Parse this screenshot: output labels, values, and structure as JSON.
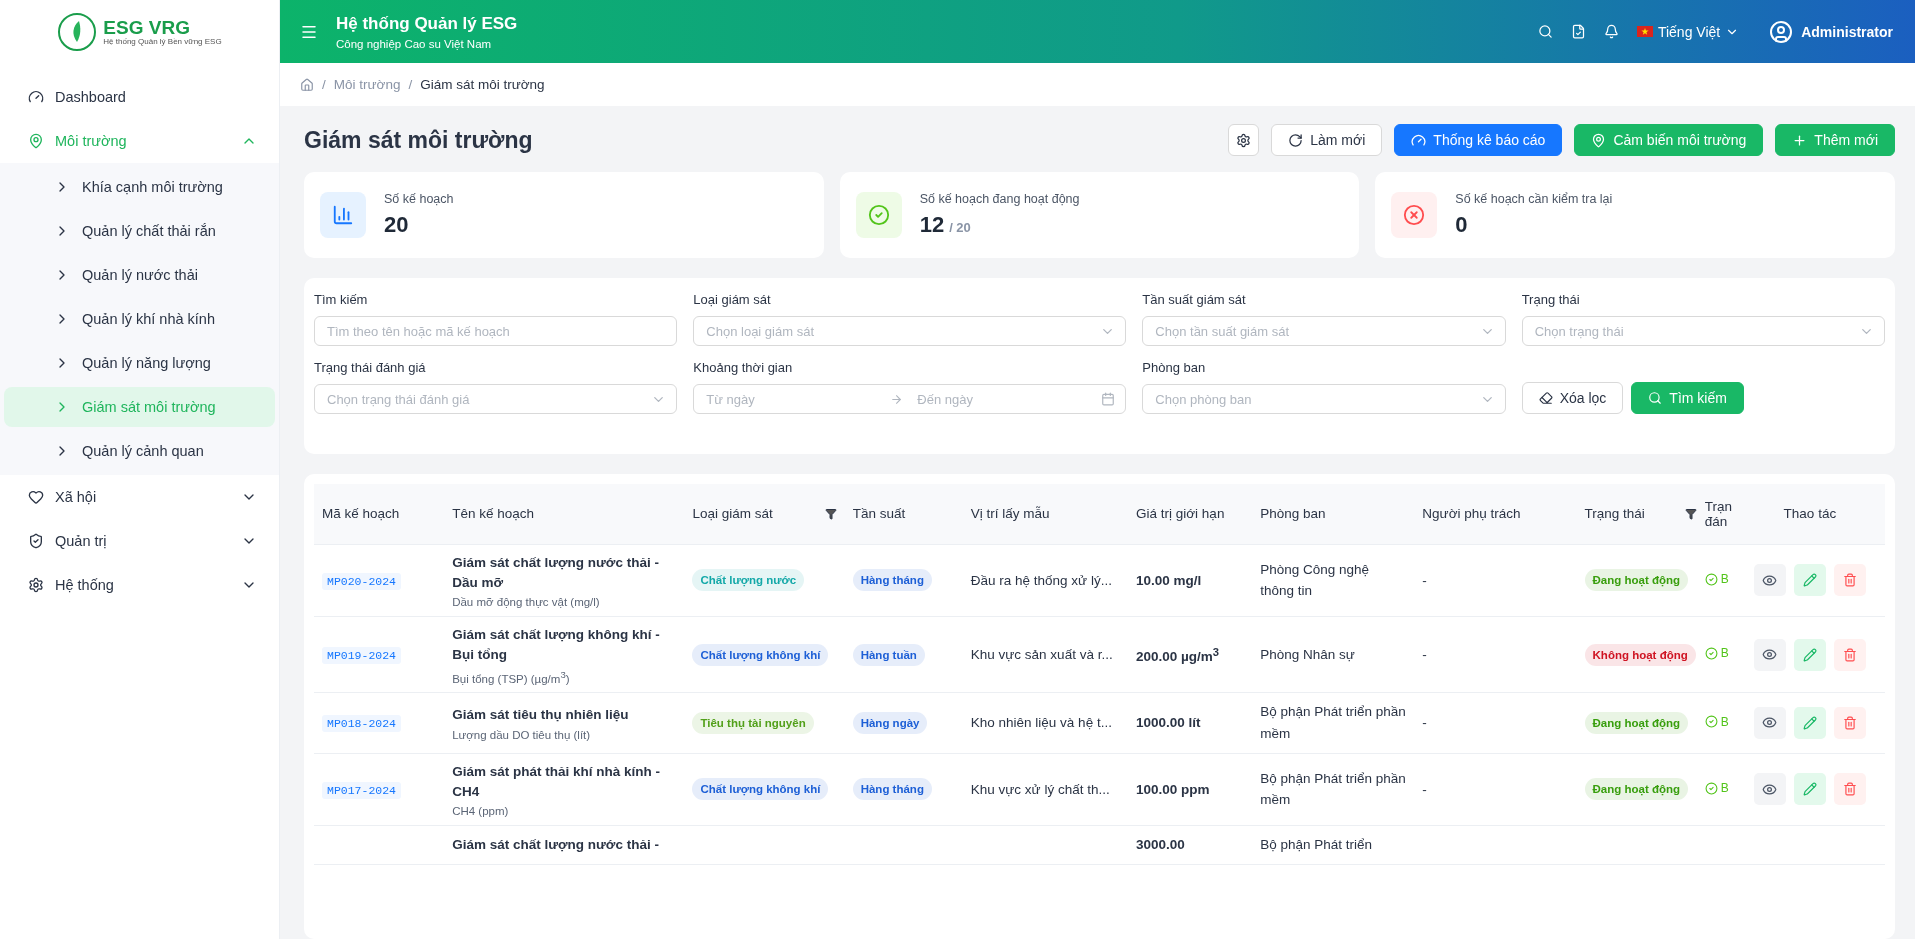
{
  "brand": {
    "name": "ESG VRG",
    "tagline": "Hệ thống Quản lý Bền vững ESG"
  },
  "sidebar": {
    "items": [
      {
        "label": "Dashboard",
        "selected": false
      },
      {
        "label": "Môi trường",
        "selected": true,
        "expanded": true,
        "children": [
          {
            "label": "Khía cạnh môi trường",
            "selected": false
          },
          {
            "label": "Quản lý chất thải rắn",
            "selected": false
          },
          {
            "label": "Quản lý nước thải",
            "selected": false
          },
          {
            "label": "Quản lý khí nhà kính",
            "selected": false
          },
          {
            "label": "Quản lý năng lượng",
            "selected": false
          },
          {
            "label": "Giám sát môi trường",
            "selected": true
          },
          {
            "label": "Quản lý cảnh quan",
            "selected": false
          }
        ]
      },
      {
        "label": "Xã hội",
        "selected": false,
        "expanded": false
      },
      {
        "label": "Quản trị",
        "selected": false,
        "expanded": false
      },
      {
        "label": "Hệ thống",
        "selected": false,
        "expanded": false
      }
    ]
  },
  "header": {
    "title": "Hệ thống Quản lý ESG",
    "subtitle": "Công nghiệp Cao su Việt Nam",
    "language": "Tiếng Việt",
    "user": "Administrator"
  },
  "breadcrumb": {
    "separator": "/",
    "items": [
      "Môi trường",
      "Giám sát môi trường"
    ]
  },
  "page_title": "Giám sát môi trường",
  "actions": [
    {
      "label": "Làm mới",
      "kind": "refresh"
    },
    {
      "label": "Thống kê báo cáo",
      "kind": "report"
    },
    {
      "label": "Cảm biến môi trường",
      "kind": "sensor"
    },
    {
      "label": "Thêm mới",
      "kind": "add"
    }
  ],
  "stats": [
    {
      "label": "Số kế hoạch",
      "value": "20",
      "kind": "chart"
    },
    {
      "label": "Số kế hoạch đang hoạt động",
      "value": "12",
      "total": "/ 20",
      "kind": "ok"
    },
    {
      "label": "Số kế hoạch cần kiểm tra lại",
      "value": "0",
      "kind": "error"
    }
  ],
  "filters": [
    {
      "label": "Tìm kiếm",
      "placeholder": "Tìm theo tên hoặc mã kế hoạch",
      "kind": "text"
    },
    {
      "label": "Loại giám sát",
      "placeholder": "Chọn loại giám sát",
      "kind": "select"
    },
    {
      "label": "Tần suất giám sát",
      "placeholder": "Chọn tần suất giám sát",
      "kind": "select"
    },
    {
      "label": "Trạng thái",
      "placeholder": "Chọn trạng thái",
      "kind": "select"
    },
    {
      "label": "Trạng thái đánh giá",
      "placeholder": "Chọn trạng thái đánh giá",
      "kind": "select"
    },
    {
      "label": "Khoảng thời gian",
      "placeholder": "Từ ngày",
      "placeholder_end": "Đến ngày",
      "kind": "range"
    },
    {
      "label": "Phòng ban",
      "placeholder": "Chọn phòng ban",
      "kind": "select"
    }
  ],
  "filter_buttons": {
    "clear": "Xóa lọc",
    "search": "Tìm kiếm"
  },
  "table": {
    "columns": [
      {
        "label": "Mã kế hoạch",
        "filter": false
      },
      {
        "label": "Tên kế hoạch",
        "filter": false
      },
      {
        "label": "Loại giám sát",
        "filter": true
      },
      {
        "label": "Tần suất",
        "filter": false
      },
      {
        "label": "Vị trí lấy mẫu",
        "filter": false
      },
      {
        "label": "Giá trị giới hạn",
        "filter": false
      },
      {
        "label": "Phòng ban",
        "filter": false
      },
      {
        "label": "Người phụ trách",
        "filter": false
      },
      {
        "label": "Trạng thái",
        "filter": true
      },
      {
        "label": "Trạn đán",
        "filter": false
      },
      {
        "label": "Thao tác",
        "filter": false
      }
    ],
    "rows": [
      {
        "code": "MP020-2024",
        "name": "Giám sát chất lượng nước thải - Dầu mỡ",
        "parameter": "Dầu mỡ động thực vật (mg/l)",
        "type": {
          "label": "Chất lượng nước",
          "color": "#13a8a8"
        },
        "frequency": "Hàng tháng",
        "location": "Đầu ra hệ thống xử lý...",
        "limit": "10.00 mg/l",
        "department": "Phòng Công nghệ thông tin",
        "owner": "-",
        "status": {
          "label": "Đang hoạt động",
          "color": "#389e0d"
        },
        "evaluation": "B"
      },
      {
        "code": "MP019-2024",
        "name": "Giám sát chất lượng không khí - Bụi tổng",
        "parameter": "Bụi tổng (TSP) (µg/m$^{3}$)",
        "type": {
          "label": "Chất lượng không khí",
          "color": "#1d5fd6"
        },
        "frequency": "Hàng tuần",
        "location": "Khu vực sản xuất và r...",
        "limit": "200.00 µg/m$^{3}$",
        "department": "Phòng Nhân sự",
        "owner": "-",
        "status": {
          "label": "Không hoạt động",
          "color": "#cf1322"
        },
        "evaluation": "B"
      },
      {
        "code": "MP018-2024",
        "name": "Giám sát tiêu thụ nhiên liệu",
        "parameter": "Lượng dầu DO tiêu thụ (lít)",
        "type": {
          "label": "Tiêu thụ tài nguyên",
          "color": "#52a01a"
        },
        "frequency": "Hàng ngày",
        "location": "Kho nhiên liệu và hệ t...",
        "limit": "1000.00 lít",
        "department": "Bộ phận Phát triển phần mềm",
        "owner": "-",
        "status": {
          "label": "Đang hoạt động",
          "color": "#389e0d"
        },
        "evaluation": "B"
      },
      {
        "code": "MP017-2024",
        "name": "Giám sát phát thải khí nhà kính - CH4",
        "parameter": "CH4 (ppm)",
        "type": {
          "label": "Chất lượng không khí",
          "color": "#1d5fd6"
        },
        "frequency": "Hàng tháng",
        "location": "Khu vực xử lý chất th...",
        "limit": "100.00 ppm",
        "department": "Bộ phận Phát triển phần mềm",
        "owner": "-",
        "status": {
          "label": "Đang hoạt động",
          "color": "#389e0d"
        },
        "evaluation": "B"
      },
      {
        "name": "Giám sát chất lượng nước thải -",
        "limit": "3000.00",
        "department": "Bộ phận Phát triển"
      }
    ]
  }
}
